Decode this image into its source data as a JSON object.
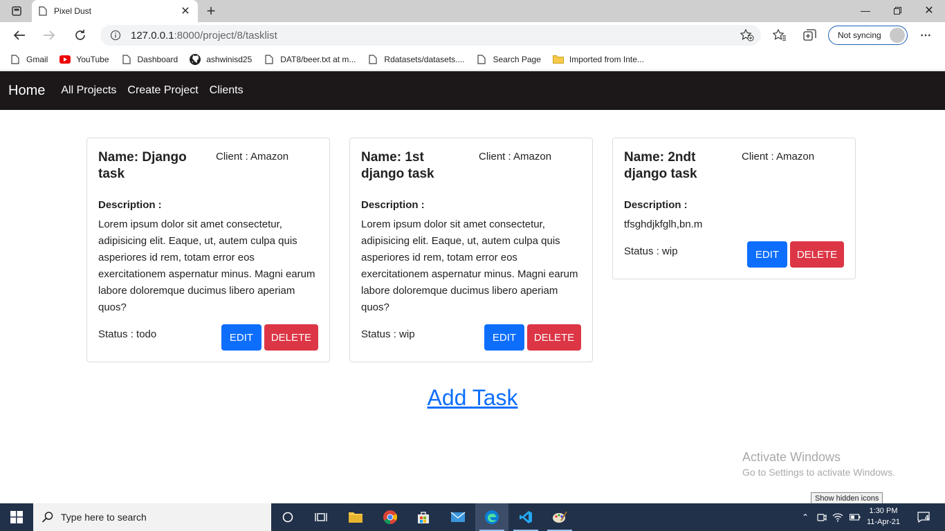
{
  "browser": {
    "tab_title": "Pixel Dust",
    "url_host": "127.0.0.1",
    "url_path": ":8000/project/8/tasklist",
    "sync_label": "Not syncing",
    "bookmarks": [
      {
        "label": "Gmail",
        "icon": "doc-icon"
      },
      {
        "label": "YouTube",
        "icon": "youtube-icon"
      },
      {
        "label": "Dashboard",
        "icon": "doc-icon"
      },
      {
        "label": "ashwinisd25",
        "icon": "github-icon"
      },
      {
        "label": "DAT8/beer.txt at m...",
        "icon": "doc-icon"
      },
      {
        "label": "Rdatasets/datasets....",
        "icon": "doc-icon"
      },
      {
        "label": "Search Page",
        "icon": "doc-icon"
      },
      {
        "label": "Imported from Inte...",
        "icon": "folder-icon"
      }
    ]
  },
  "navbar": {
    "brand": "Home",
    "links": [
      "All Projects",
      "Create Project",
      "Clients"
    ]
  },
  "cards": [
    {
      "name": "Name: Django task",
      "client": "Client : Amazon",
      "description_label": "Description :",
      "description": "Lorem ipsum dolor sit amet consectetur, adipisicing elit. Eaque, ut, autem culpa quis asperiores id rem, totam error eos exercitationem aspernatur minus. Magni earum labore doloremque ducimus libero aperiam quos?",
      "status": "Status : todo",
      "edit_label": "EDIT",
      "delete_label": "DELETE"
    },
    {
      "name": "Name: 1st django task",
      "client": "Client : Amazon",
      "description_label": "Description :",
      "description": "Lorem ipsum dolor sit amet consectetur, adipisicing elit. Eaque, ut, autem culpa quis asperiores id rem, totam error eos exercitationem aspernatur minus. Magni earum labore doloremque ducimus libero aperiam quos?",
      "status": "Status : wip",
      "edit_label": "EDIT",
      "delete_label": "DELETE"
    },
    {
      "name": "Name: 2ndt django task",
      "client": "Client : Amazon",
      "description_label": "Description :",
      "description": "tfsghdjkfglh,bn.m",
      "status": "Status : wip",
      "edit_label": "EDIT",
      "delete_label": "DELETE"
    }
  ],
  "add_task_label": "Add Task",
  "watermark": {
    "line1": "Activate Windows",
    "line2": "Go to Settings to activate Windows."
  },
  "taskbar": {
    "search_placeholder": "Type here to search",
    "tooltip": "Show hidden icons",
    "time": "1:30 PM",
    "date": "11-Apr-21",
    "notification_count": "4"
  },
  "colors": {
    "primary": "#0d6efd",
    "danger": "#dc3545",
    "navbar_bg": "#1c1819",
    "taskbar_bg": "#21314a"
  }
}
